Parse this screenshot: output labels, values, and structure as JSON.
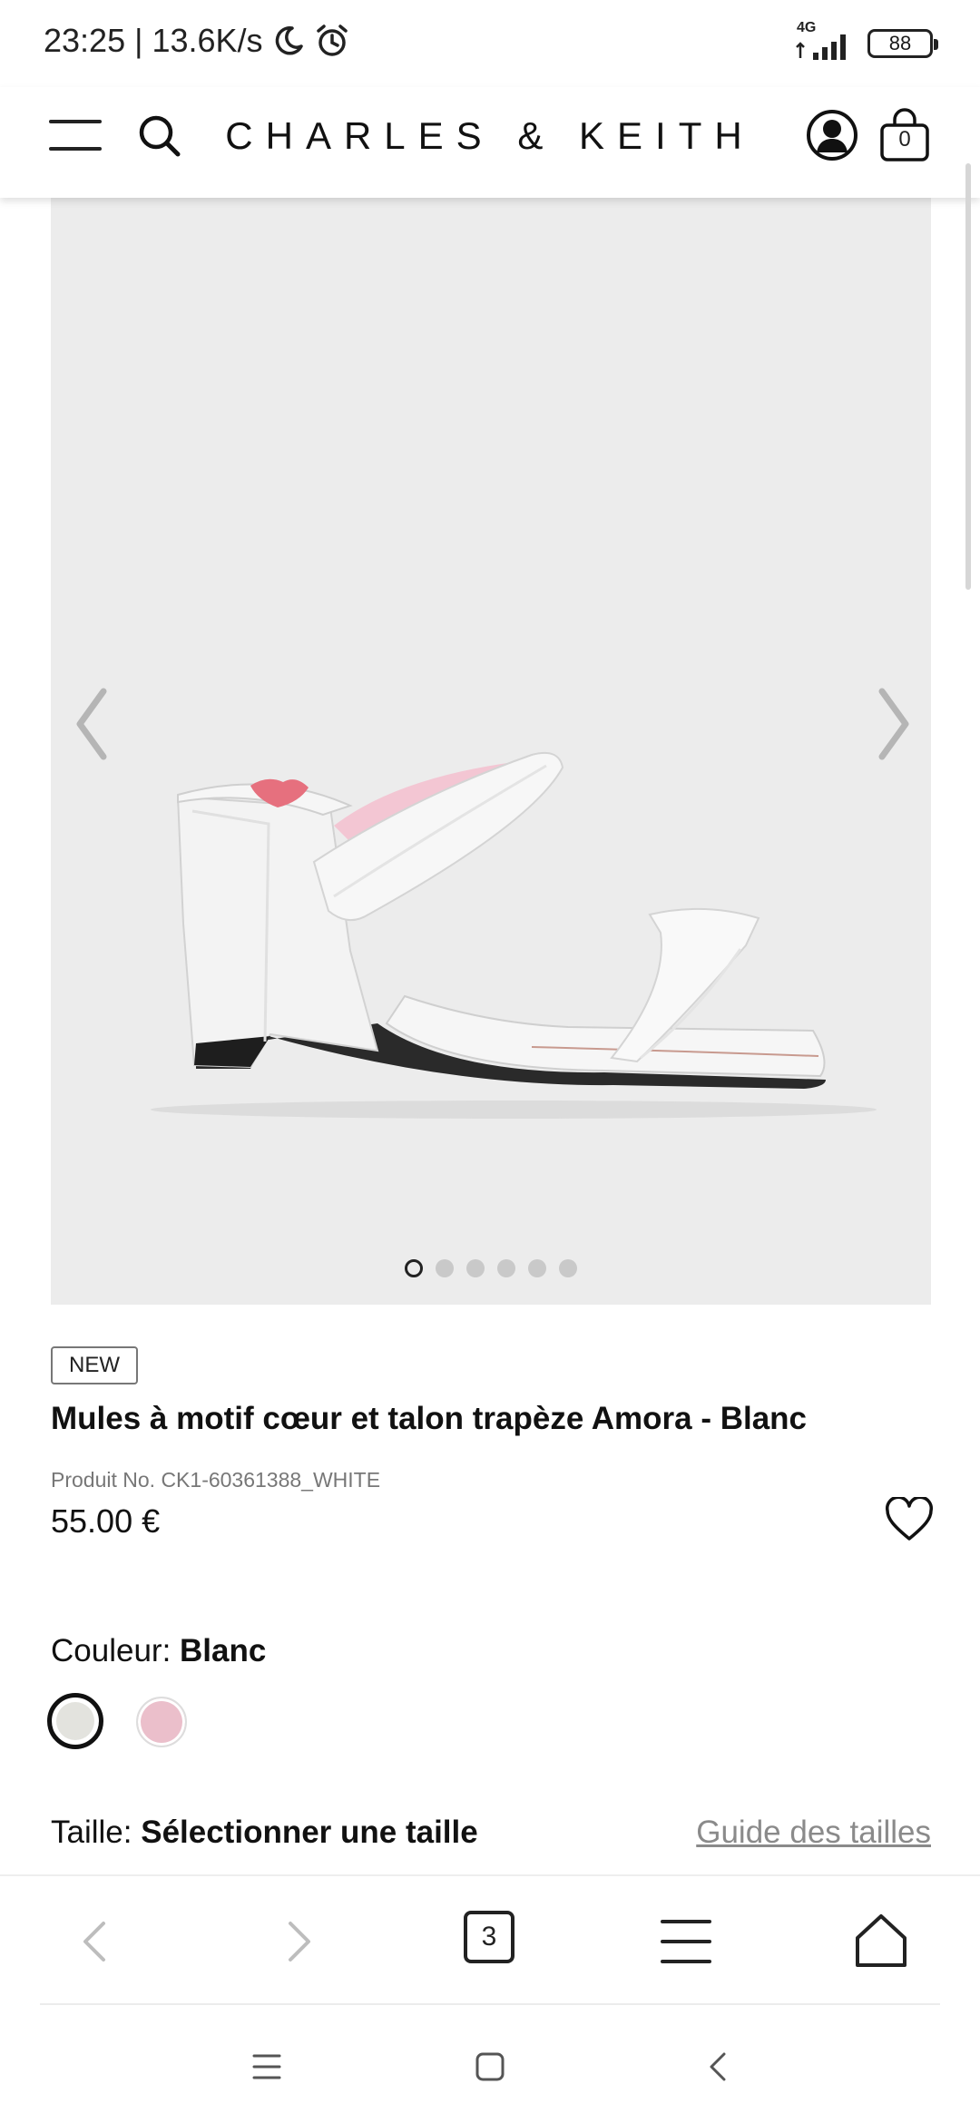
{
  "status_bar": {
    "time": "23:25",
    "separator": "|",
    "speed": "13.6K/s",
    "network": "4G",
    "battery": "88"
  },
  "header": {
    "brand": "CHARLES & KEITH",
    "cart_count": "0"
  },
  "product": {
    "badge": "NEW",
    "title": "Mules à motif cœur et talon trapèze Amora - Blanc",
    "product_no": "Produit No. CK1-60361388_WHITE",
    "price": "55.00 €",
    "image_dots_count": 6,
    "active_dot": 0
  },
  "color": {
    "label": "Couleur:",
    "selected": "Blanc",
    "swatches": [
      "#e3e3de",
      "#ebbfcb"
    ]
  },
  "size": {
    "label": "Taille:",
    "value": "Sélectionner une taille",
    "guide_link": "Guide des tailles"
  },
  "browser_bar": {
    "tab_count": "3"
  },
  "icons": {
    "menu": "menu-icon",
    "search": "search-icon",
    "account": "account-icon",
    "bag": "shopping-bag-icon",
    "wishlist": "heart-icon",
    "moon": "moon-icon",
    "alarm": "alarm-icon"
  },
  "colors": {
    "image_bg": "#ececec",
    "text": "#111111",
    "muted": "#777777"
  }
}
